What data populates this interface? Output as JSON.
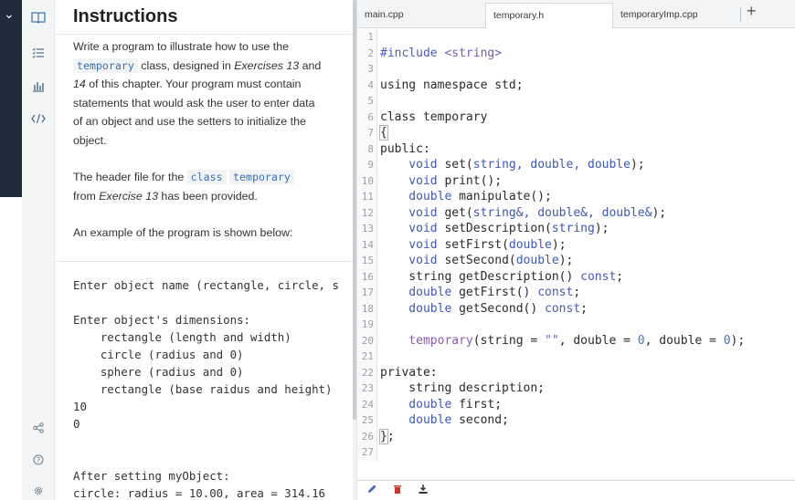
{
  "sidebar": {
    "collapse_icon": "chevron-down-icon",
    "icons": [
      "book-icon",
      "checklist-icon",
      "bar-chart-icon",
      "code-icon",
      "share-icon",
      "help-icon",
      "settings-icon"
    ]
  },
  "instructions": {
    "title": "Instructions",
    "p1": {
      "t1": "Write a program to illustrate how to use the",
      "code": "temporary",
      "t2": " class, designed in ",
      "em1": "Exercises 13",
      "t3": " and",
      "em2": "14",
      "t4": " of this chapter. Your program must contain",
      "t5": "statements that would ask the user to enter data",
      "t6": "of an object and use the setters to initialize the",
      "t7": "object."
    },
    "p2": {
      "t1": "The header file for the ",
      "code1": "class",
      "code2": "temporary",
      "t2": "from ",
      "em": "Exercise 13",
      "t3": " has been provided."
    },
    "p3": "An example of the program is shown below:",
    "sample_lines": [
      "Enter object name (rectangle, circle, s",
      "",
      "Enter object's dimensions:",
      "    rectangle (length and width)",
      "    circle (radius and 0)",
      "    sphere (radius and 0)",
      "    rectangle (base raidus and height)",
      "10",
      "0",
      "",
      "",
      "After setting myObject:",
      "circle: radius = 10.00, area = 314.16"
    ]
  },
  "editor": {
    "tabs": [
      "main.cpp",
      "temporary.h",
      "temporaryImp.cpp"
    ],
    "active_tab": "temporary.h",
    "add_tab": "+",
    "line_numbers": [
      "1",
      "2",
      "3",
      "4",
      "5",
      "6",
      "7",
      "8",
      "9",
      "10",
      "11",
      "12",
      "13",
      "14",
      "15",
      "16",
      "17",
      "18",
      "19",
      "20",
      "21",
      "22",
      "23",
      "24",
      "25",
      "26",
      "27"
    ],
    "code": {
      "l2_a": "#include ",
      "l2_b": "<string>",
      "l4": "using namespace std;",
      "l6": "class temporary",
      "l7": "{",
      "l8": "public:",
      "l9_a": "    void ",
      "l9_b": "set(",
      "l9_c": "string, double, double",
      "l9_d": ");",
      "l10_a": "    void ",
      "l10_b": "print();",
      "l11_a": "    double ",
      "l11_b": "manipulate();",
      "l12_a": "    void ",
      "l12_b": "get(",
      "l12_c": "string&, double&, double&",
      "l12_d": ");",
      "l13_a": "    void ",
      "l13_b": "setDescription(",
      "l13_c": "string",
      "l13_d": ");",
      "l14_a": "    void ",
      "l14_b": "setFirst(",
      "l14_c": "double",
      "l14_d": ");",
      "l15_a": "    void ",
      "l15_b": "setSecond(",
      "l15_c": "double",
      "l15_d": ");",
      "l16_a": "    string ",
      "l16_b": "getDescription() ",
      "l16_c": "const",
      "l16_d": ";",
      "l17_a": "    double ",
      "l17_b": "getFirst() ",
      "l17_c": "const",
      "l17_d": ";",
      "l18_a": "    double ",
      "l18_b": "getSecond() ",
      "l18_c": "const",
      "l18_d": ";",
      "l20_a": "    temporary",
      "l20_b": "(string = ",
      "l20_c": "\"\"",
      "l20_d": ", double = ",
      "l20_e": "0",
      "l20_f": ", double = ",
      "l20_g": "0",
      "l20_h": ");",
      "l22": "private:",
      "l23": "    string description;",
      "l24_a": "    double ",
      "l24_b": "first;",
      "l25_a": "    double ",
      "l25_b": "second;",
      "l26_a": "}",
      "l26_b": ";"
    },
    "bottom_icons": [
      "pencil-icon",
      "trash-icon",
      "download-icon"
    ]
  }
}
